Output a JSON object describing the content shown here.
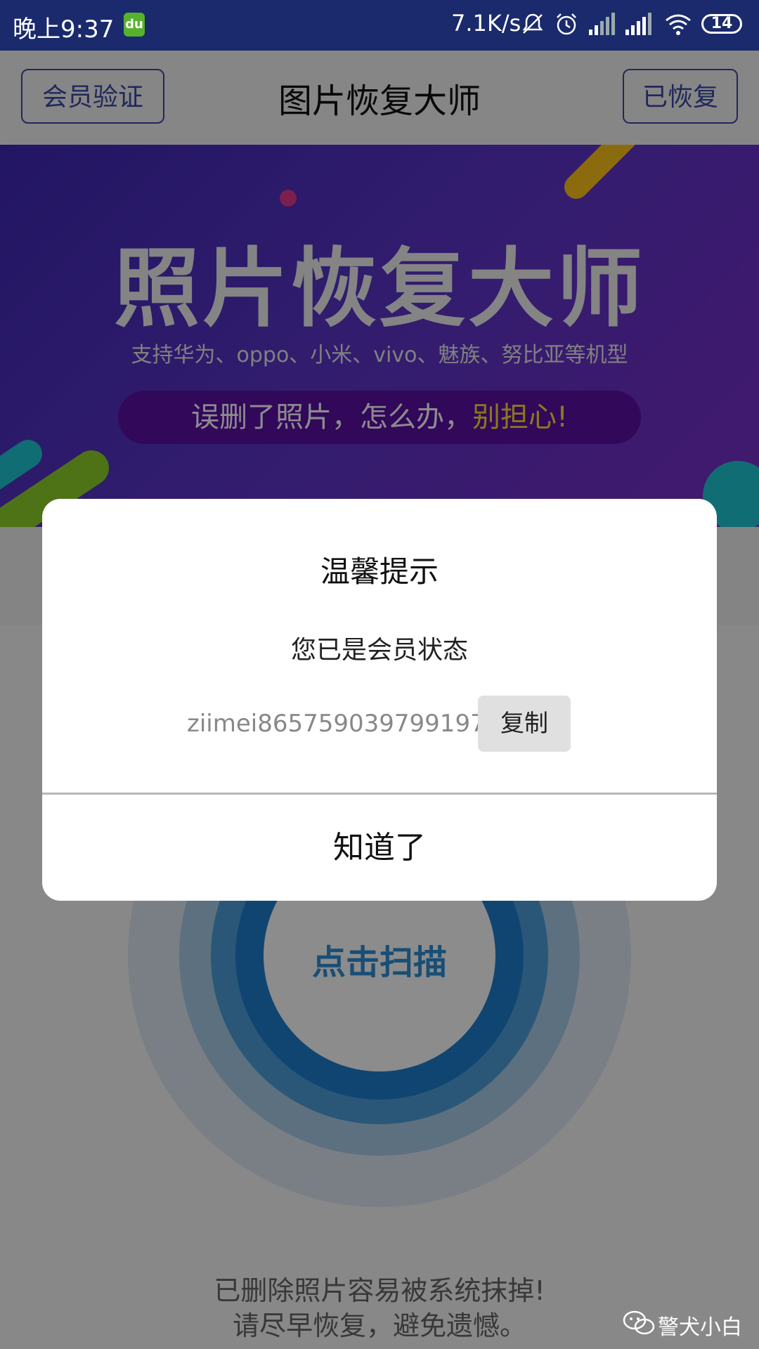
{
  "status_bar": {
    "time": "晚上9:37",
    "notification_icon_text": "du",
    "network_speed": "7.1K/s",
    "icons": [
      "mute-icon",
      "alarm-icon",
      "signal-icon",
      "signal-icon",
      "wifi-icon"
    ],
    "battery": "14"
  },
  "header": {
    "left_button": "会员验证",
    "title": "图片恢复大师",
    "right_button": "已恢复"
  },
  "banner": {
    "title": "照片恢复大师",
    "subtitle": "支持华为、oppo、小米、vivo、魅族、努比亚等机型",
    "pill_text": "误删了照片，怎么办，",
    "pill_highlight": "别担心!"
  },
  "main": {
    "scan_button": "点击扫描",
    "warning_line1": "已删除照片容易被系统抹掉!",
    "warning_line2": "请尽早恢复，避免遗憾。"
  },
  "dialog": {
    "title": "温馨提示",
    "message": "您已是会员状态",
    "member_id": "ziimei865759039799197",
    "copy_button": "复制",
    "confirm_button": "知道了"
  },
  "watermark": {
    "text": "警犬小白"
  },
  "colors": {
    "status_bar": "#1a2a6c",
    "accent": "#3b4aa7",
    "banner_start": "#3f28b5",
    "banner_end": "#7b2fc9",
    "highlight": "#ffdd33",
    "scan_blue": "#2f8fd6"
  }
}
